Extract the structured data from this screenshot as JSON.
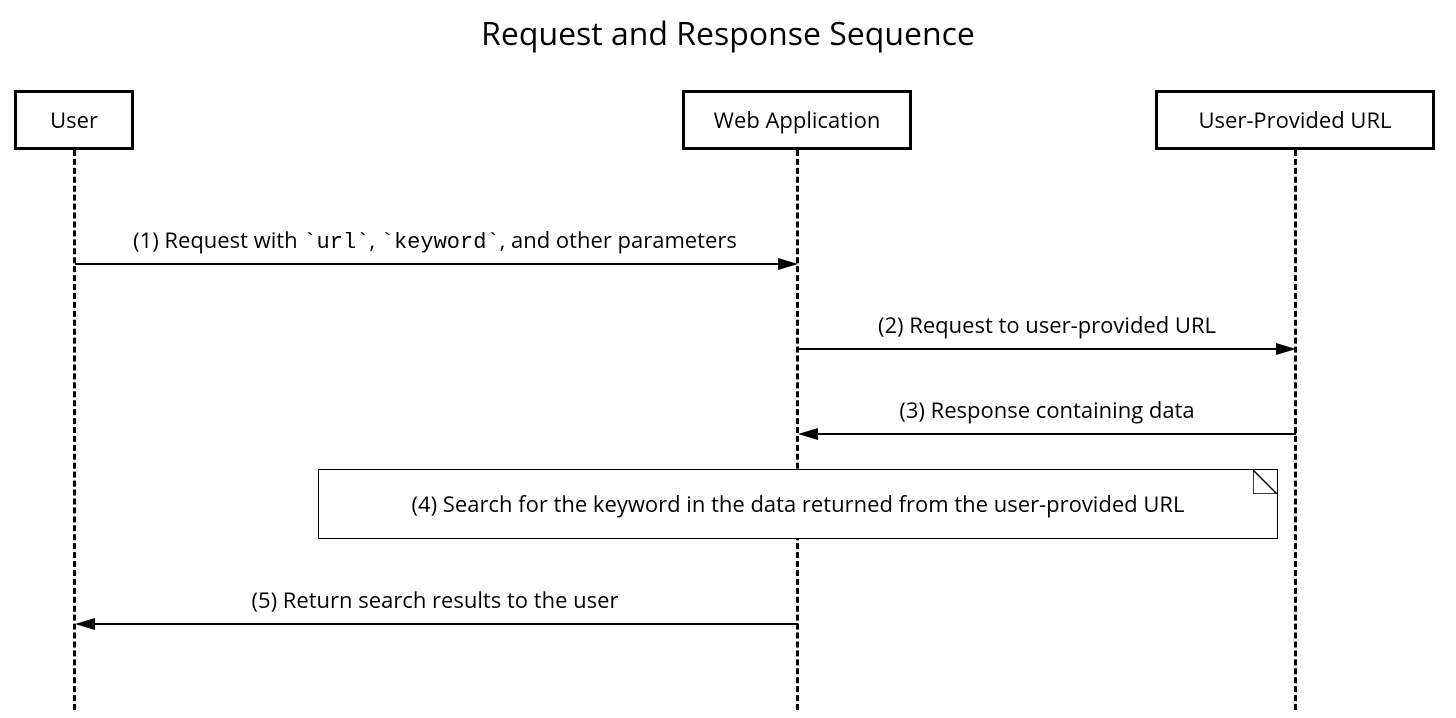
{
  "title": "Request and Response Sequence",
  "actors": {
    "user": "User",
    "webapp": "Web Application",
    "url": "User-Provided URL"
  },
  "messages": {
    "m1_prefix": "(1) Request with ",
    "m1_code1": "`url`",
    "m1_mid": ", ",
    "m1_code2": "`keyword`",
    "m1_suffix": ", and other parameters",
    "m2": "(2) Request to user-provided URL",
    "m3": "(3) Response containing data",
    "m4": "(4) Search for the keyword in the data returned from the user-provided URL",
    "m5": "(5) Return search results to the user"
  }
}
